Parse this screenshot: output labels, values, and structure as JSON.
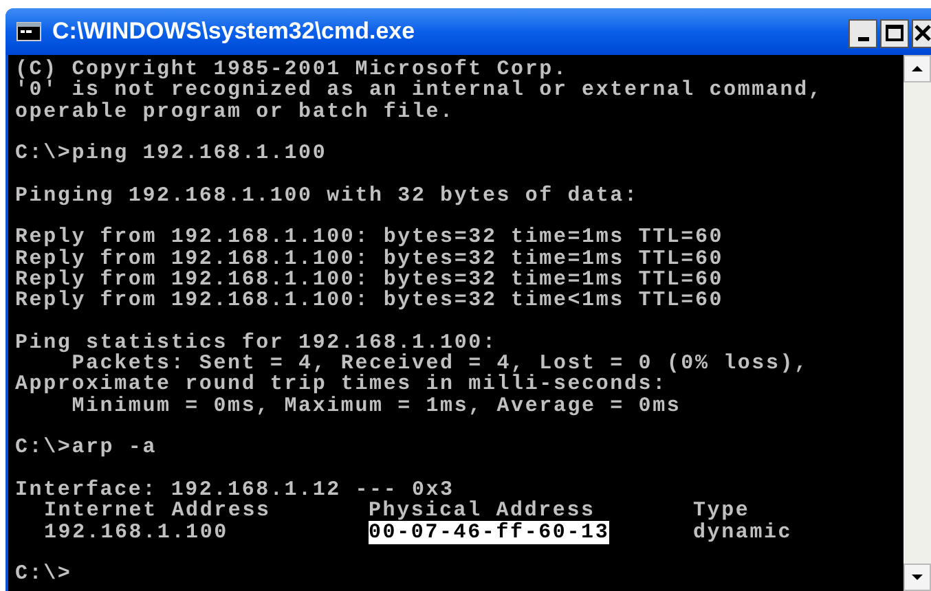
{
  "window": {
    "title": "C:\\WINDOWS\\system32\\cmd.exe"
  },
  "console": {
    "lines": [
      {
        "kind": "text",
        "text": "(C) Copyright 1985-2001 Microsoft Corp."
      },
      {
        "kind": "text",
        "text": "'0' is not recognized as an internal or external command,"
      },
      {
        "kind": "text",
        "text": "operable program or batch file."
      },
      {
        "kind": "blank"
      },
      {
        "kind": "text",
        "text": "C:\\>ping 192.168.1.100"
      },
      {
        "kind": "blank"
      },
      {
        "kind": "text",
        "text": "Pinging 192.168.1.100 with 32 bytes of data:"
      },
      {
        "kind": "blank"
      },
      {
        "kind": "text",
        "text": "Reply from 192.168.1.100: bytes=32 time=1ms TTL=60"
      },
      {
        "kind": "text",
        "text": "Reply from 192.168.1.100: bytes=32 time=1ms TTL=60"
      },
      {
        "kind": "text",
        "text": "Reply from 192.168.1.100: bytes=32 time=1ms TTL=60"
      },
      {
        "kind": "text",
        "text": "Reply from 192.168.1.100: bytes=32 time<1ms TTL=60"
      },
      {
        "kind": "blank"
      },
      {
        "kind": "text",
        "text": "Ping statistics for 192.168.1.100:"
      },
      {
        "kind": "text",
        "text": "    Packets: Sent = 4, Received = 4, Lost = 0 (0% loss),"
      },
      {
        "kind": "text",
        "text": "Approximate round trip times in milli-seconds:"
      },
      {
        "kind": "text",
        "text": "    Minimum = 0ms, Maximum = 1ms, Average = 0ms"
      },
      {
        "kind": "blank"
      },
      {
        "kind": "text",
        "text": "C:\\>arp -a"
      },
      {
        "kind": "blank"
      },
      {
        "kind": "text",
        "text": "Interface: 192.168.1.12 --- 0x3"
      },
      {
        "kind": "row",
        "cells": [
          {
            "text": "Internet Address",
            "selected": false
          },
          {
            "text": "Physical Address",
            "selected": false
          },
          {
            "text": "Type",
            "selected": false
          }
        ]
      },
      {
        "kind": "row",
        "cells": [
          {
            "text": "192.168.1.100",
            "selected": false
          },
          {
            "text": "00-07-46-ff-60-13",
            "selected": true
          },
          {
            "text": "dynamic",
            "selected": false
          }
        ]
      },
      {
        "kind": "blank"
      },
      {
        "kind": "text",
        "text": "C:\\>"
      }
    ]
  }
}
